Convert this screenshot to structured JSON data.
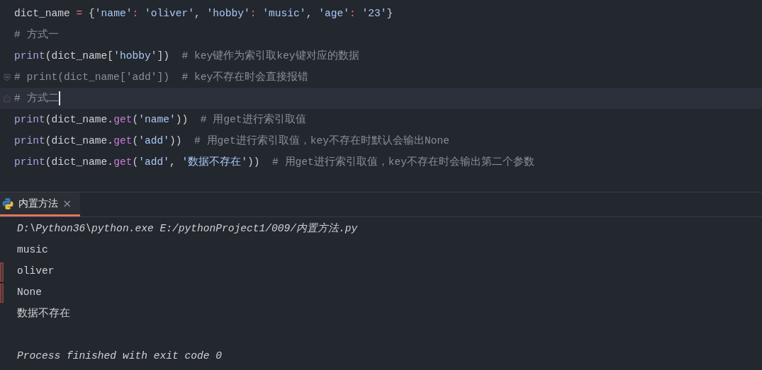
{
  "editor": {
    "lines": [
      {
        "tokens": [
          {
            "text": "dict_name ",
            "kind": "plain"
          },
          {
            "text": "=",
            "kind": "operator"
          },
          {
            "text": " {",
            "kind": "plain"
          },
          {
            "text": "'name'",
            "kind": "string"
          },
          {
            "text": ": ",
            "kind": "operator"
          },
          {
            "text": "'oliver'",
            "kind": "string"
          },
          {
            "text": ", ",
            "kind": "plain"
          },
          {
            "text": "'hobby'",
            "kind": "string"
          },
          {
            "text": ": ",
            "kind": "operator"
          },
          {
            "text": "'music'",
            "kind": "string"
          },
          {
            "text": ", ",
            "kind": "plain"
          },
          {
            "text": "'age'",
            "kind": "string"
          },
          {
            "text": ": ",
            "kind": "operator"
          },
          {
            "text": "'23'",
            "kind": "string"
          },
          {
            "text": "}",
            "kind": "plain"
          }
        ],
        "current": false
      },
      {
        "tokens": [
          {
            "text": "# 方式一",
            "kind": "comment"
          }
        ],
        "current": false
      },
      {
        "tokens": [
          {
            "text": "print",
            "kind": "builtin"
          },
          {
            "text": "(dict_name[",
            "kind": "plain"
          },
          {
            "text": "'hobby'",
            "kind": "string"
          },
          {
            "text": "])  ",
            "kind": "plain"
          },
          {
            "text": "# key键作为索引取key键对应的数据",
            "kind": "comment"
          }
        ],
        "current": false
      },
      {
        "tokens": [
          {
            "text": "# print(dict_name['add'])  # key不存在时会直接报错",
            "kind": "comment"
          }
        ],
        "current": false,
        "fold_start": true
      },
      {
        "tokens": [
          {
            "text": "# 方式二",
            "kind": "comment"
          }
        ],
        "current": true,
        "fold_end": true
      },
      {
        "tokens": [
          {
            "text": "print",
            "kind": "builtin"
          },
          {
            "text": "(dict_name.",
            "kind": "plain"
          },
          {
            "text": "get",
            "kind": "method"
          },
          {
            "text": "(",
            "kind": "plain"
          },
          {
            "text": "'name'",
            "kind": "string"
          },
          {
            "text": "))  ",
            "kind": "plain"
          },
          {
            "text": "# 用get进行索引取值",
            "kind": "comment"
          }
        ],
        "current": false
      },
      {
        "tokens": [
          {
            "text": "print",
            "kind": "builtin"
          },
          {
            "text": "(dict_name.",
            "kind": "plain"
          },
          {
            "text": "get",
            "kind": "method"
          },
          {
            "text": "(",
            "kind": "plain"
          },
          {
            "text": "'add'",
            "kind": "string"
          },
          {
            "text": "))  ",
            "kind": "plain"
          },
          {
            "text": "# 用get进行索引取值，key不存在时默认会输出None",
            "kind": "comment"
          }
        ],
        "current": false
      },
      {
        "tokens": [
          {
            "text": "print",
            "kind": "builtin"
          },
          {
            "text": "(dict_name.",
            "kind": "plain"
          },
          {
            "text": "get",
            "kind": "method"
          },
          {
            "text": "(",
            "kind": "plain"
          },
          {
            "text": "'add'",
            "kind": "string"
          },
          {
            "text": ", ",
            "kind": "plain"
          },
          {
            "text": "'数据不存在'",
            "kind": "string"
          },
          {
            "text": "))  ",
            "kind": "plain"
          },
          {
            "text": "# 用get进行索引取值，key不存在时会输出第二个参数",
            "kind": "comment"
          }
        ],
        "current": false
      }
    ]
  },
  "run_panel": {
    "tabs": [
      {
        "label": "内置方法",
        "close": "×",
        "selected": true
      }
    ],
    "output": [
      {
        "text": "D:\\Python36\\python.exe E:/pythonProject1/009/内置方法.py",
        "kind": "command",
        "marked": false
      },
      {
        "text": "music",
        "kind": "stdout",
        "marked": false
      },
      {
        "text": "oliver",
        "kind": "stdout",
        "marked": true
      },
      {
        "text": "None",
        "kind": "stdout",
        "marked": true
      },
      {
        "text": "数据不存在",
        "kind": "stdout",
        "marked": false
      },
      {
        "text": "Process finished with exit code 0",
        "kind": "exit",
        "marked": false
      }
    ]
  }
}
